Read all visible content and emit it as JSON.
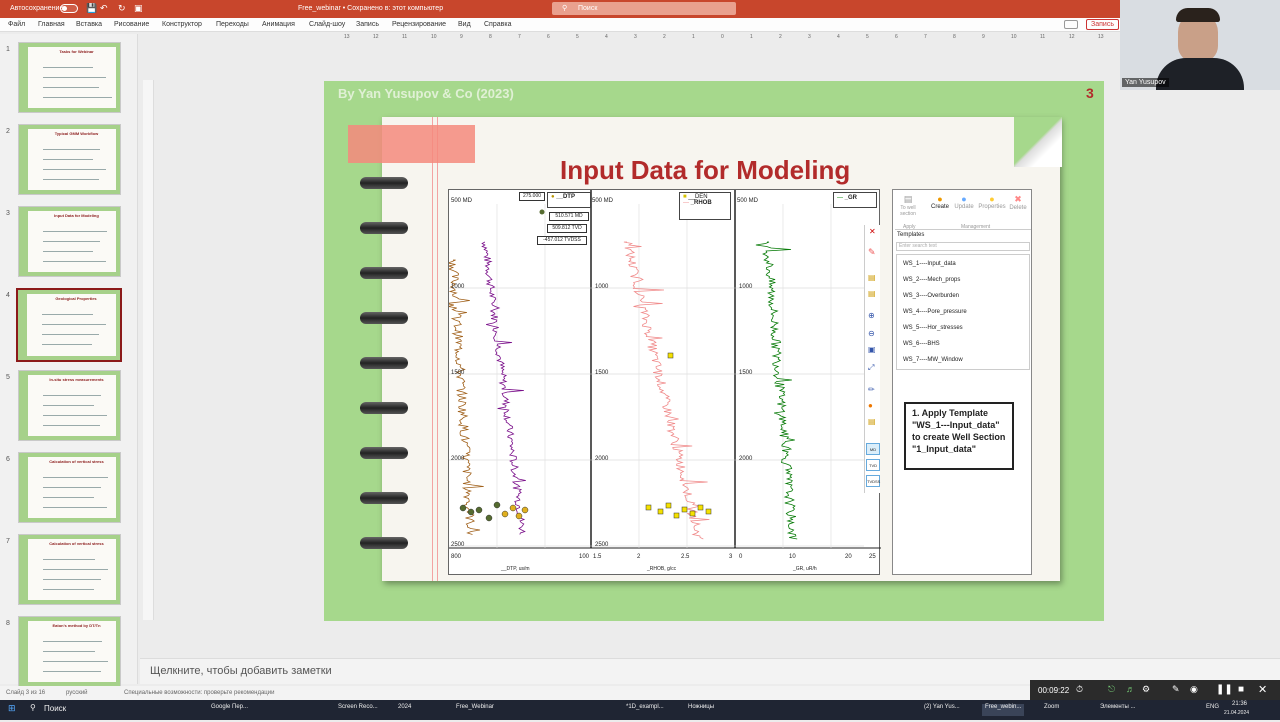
{
  "titlebar": {
    "autosave_label": "Автосохранение",
    "toggle_state": "Откл.",
    "document_title": "Free_webinar • Сохранено в: этот компьютер",
    "search_placeholder": "Поиск",
    "account": "",
    "colors": {
      "bar": "#c8462c"
    }
  },
  "ribbon": {
    "tabs": [
      "Файл",
      "Главная",
      "Вставка",
      "Рисование",
      "Конструктор",
      "Переходы",
      "Анимация",
      "Слайд-шоу",
      "Запись",
      "Рецензирование",
      "Вид",
      "Справка"
    ],
    "record_button": "Запись"
  },
  "ruler": {
    "labels": [
      "13",
      "12",
      "11",
      "10",
      "9",
      "8",
      "7",
      "6",
      "5",
      "4",
      "3",
      "2",
      "1",
      "0",
      "1",
      "2",
      "3",
      "4",
      "5",
      "6",
      "7",
      "8",
      "9",
      "10",
      "11",
      "12",
      "13"
    ]
  },
  "thumbnails": [
    {
      "num": "1",
      "title": "Tasks for Webinar"
    },
    {
      "num": "2",
      "title": "Typical GMM Workflow"
    },
    {
      "num": "3",
      "title": "Input Data for Modeling"
    },
    {
      "num": "4",
      "title": "Geological Properties"
    },
    {
      "num": "5",
      "title": "In-situ stress measurements"
    },
    {
      "num": "6",
      "title": "Calculation of vertical stress"
    },
    {
      "num": "7",
      "title": "Calculation of vertical stress"
    },
    {
      "num": "8",
      "title": "Eaton's method by DT/Tn"
    }
  ],
  "slide": {
    "author": "By Yan Yusupov & Co (2023)",
    "number": "3",
    "title": "Input Data for Modeling",
    "callout": "1. Apply Template \"WS_1---Input_data\" to create Well Section \"1_Input_data\"",
    "colors": {
      "bg": "#a6d88c",
      "title": "#b22b2b",
      "paper": "#f7f5ef"
    }
  },
  "chart": {
    "md_label": "500 MD",
    "depths": [
      "1000",
      "1500",
      "2000",
      "2500"
    ],
    "tooltip": [
      "275.000",
      "510.571 MD",
      "509.812 TVD",
      "-457.012 TVDSS"
    ],
    "track1": {
      "legend": "__DTP",
      "axis_min": "800",
      "axis_max": "100",
      "axis_label": "__DTP, us/m"
    },
    "track2": {
      "legend1": "__DEN",
      "legend2": "_RHOB",
      "axis_ticks": [
        "1.5",
        "2",
        "2.5",
        "3"
      ],
      "axis_label": "_RHOB, g/cc"
    },
    "track3": {
      "legend": "_GR",
      "axis_ticks": [
        "0",
        "10",
        "20",
        "25"
      ],
      "axis_label": "_GR, uR/h"
    },
    "toolbar_tags": [
      "MD",
      "TVD",
      "TVDSS"
    ]
  },
  "template_panel": {
    "actions": [
      "To well section",
      "Create",
      "Update",
      "Properties",
      "Delete"
    ],
    "groups": [
      "Apply",
      "Management"
    ],
    "section_label": "Templates",
    "search_placeholder": "Enter search text",
    "items": [
      "WS_1----Input_data",
      "WS_2----Mech_props",
      "WS_3----Overburden",
      "WS_4----Pore_pressure",
      "WS_5----Hor_stresses",
      "WS_6----BHS",
      "WS_7----MW_Window"
    ]
  },
  "notes": {
    "placeholder": "Щелкните, чтобы добавить заметки"
  },
  "statusbar": {
    "slide_info": "Слайд 3 из 16",
    "language": "русский",
    "accessibility": "Специальные возможности: проверьте рекомендации"
  },
  "webcam": {
    "name": "Yan Yusupov"
  },
  "zoom": {
    "timer": "00:09:22"
  },
  "taskbar": {
    "search": "Поиск",
    "apps": [
      "Google Пер...",
      "Screen Reco...",
      "2024",
      "Free_Webinar",
      "*1D_exampl...",
      "Ножницы",
      "(2) Yan Yus...",
      "Free_webin...",
      "Zoom",
      "Элементы ..."
    ],
    "lang": "ENG",
    "time": "21:36",
    "date": "21.04.2024"
  }
}
